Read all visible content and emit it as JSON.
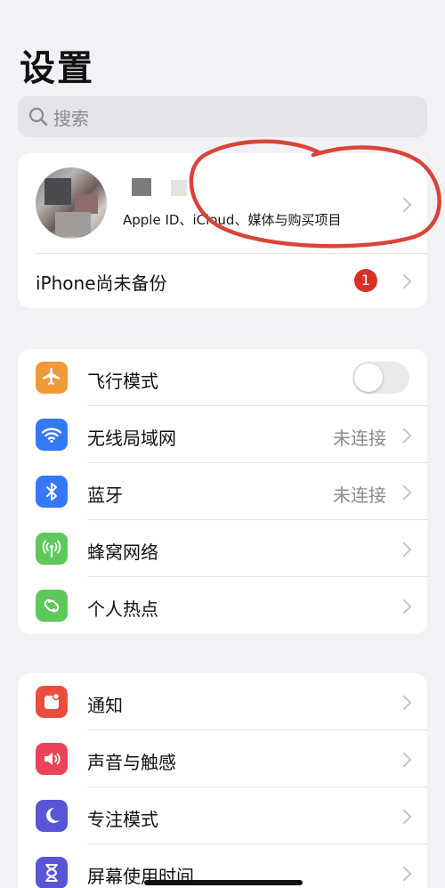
{
  "header": {
    "title": "设置"
  },
  "search": {
    "placeholder": "搜索"
  },
  "account": {
    "subtitle": "Apple ID、iCloud、媒体与购买项目",
    "backup_label": "iPhone尚未备份",
    "badge_count": "1"
  },
  "network": {
    "items": [
      {
        "label": "飞行模式",
        "icon": "airplane-icon",
        "color": "#f09a37",
        "toggle": "off"
      },
      {
        "label": "无线局域网",
        "value": "未连接",
        "icon": "wifi-icon",
        "color": "#3478f6"
      },
      {
        "label": "蓝牙",
        "value": "未连接",
        "icon": "bluetooth-icon",
        "color": "#3478f6"
      },
      {
        "label": "蜂窝网络",
        "icon": "cellular-icon",
        "color": "#5fc85b"
      },
      {
        "label": "个人热点",
        "icon": "hotspot-icon",
        "color": "#5fc85b"
      }
    ]
  },
  "notifications": {
    "items": [
      {
        "label": "通知",
        "icon": "bell-icon",
        "color": "#eb4d3d"
      },
      {
        "label": "声音与触感",
        "icon": "speaker-icon",
        "color": "#eb445a"
      },
      {
        "label": "专注模式",
        "icon": "moon-icon",
        "color": "#5856d6"
      },
      {
        "label": "屏幕使用时间",
        "icon": "hourglass-icon",
        "color": "#5856d6"
      }
    ]
  },
  "colors": {
    "background": "#f2f1f6",
    "badge": "#d93025",
    "annotation": "#d9443a"
  }
}
